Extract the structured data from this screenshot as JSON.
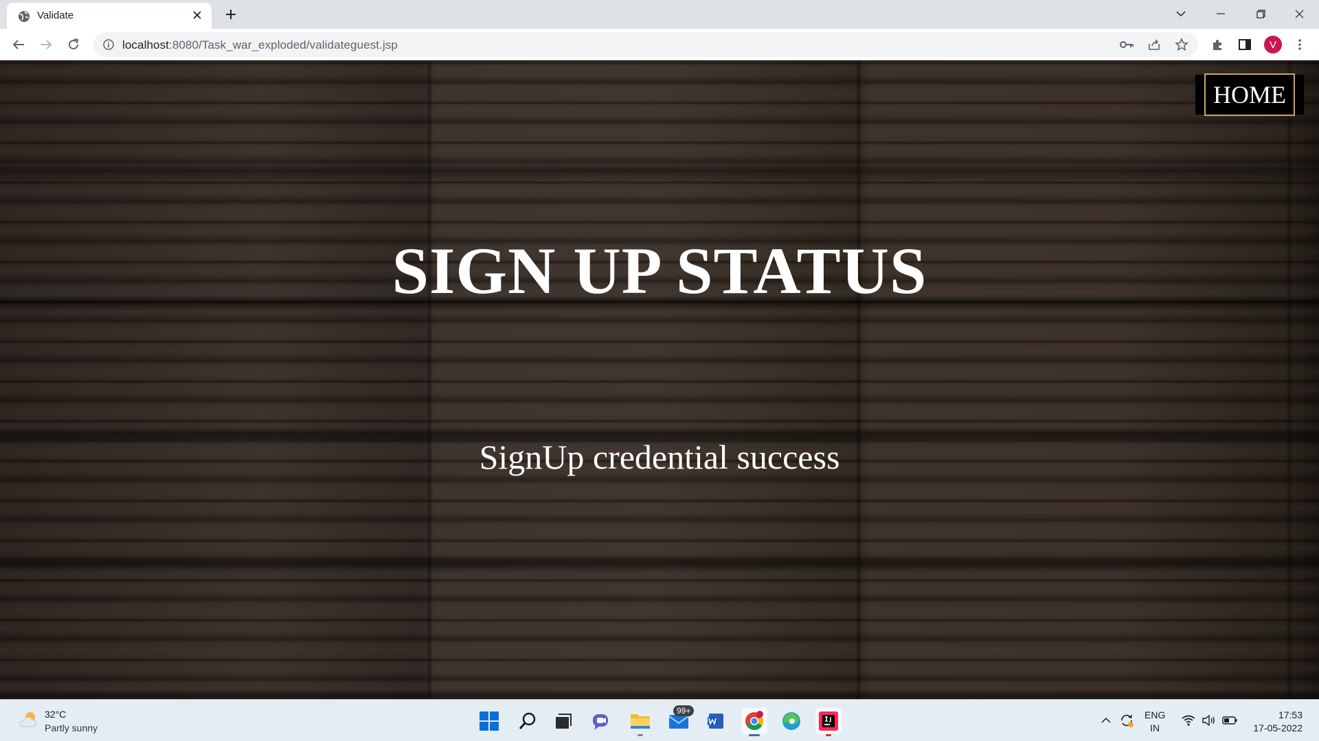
{
  "browser": {
    "tab_title": "Validate",
    "url_host": "localhost",
    "url_rest": ":8080/Task_war_exploded/validateguest.jsp",
    "profile_initial": "V"
  },
  "page": {
    "title": "SIGN UP STATUS",
    "message": "SignUp credential success",
    "home_label": "HOME"
  },
  "taskbar": {
    "temperature": "32°C",
    "weather": "Partly sunny",
    "mail_badge": "99+",
    "lang_top": "ENG",
    "lang_bottom": "IN",
    "time": "17:53",
    "date": "17-05-2022"
  }
}
